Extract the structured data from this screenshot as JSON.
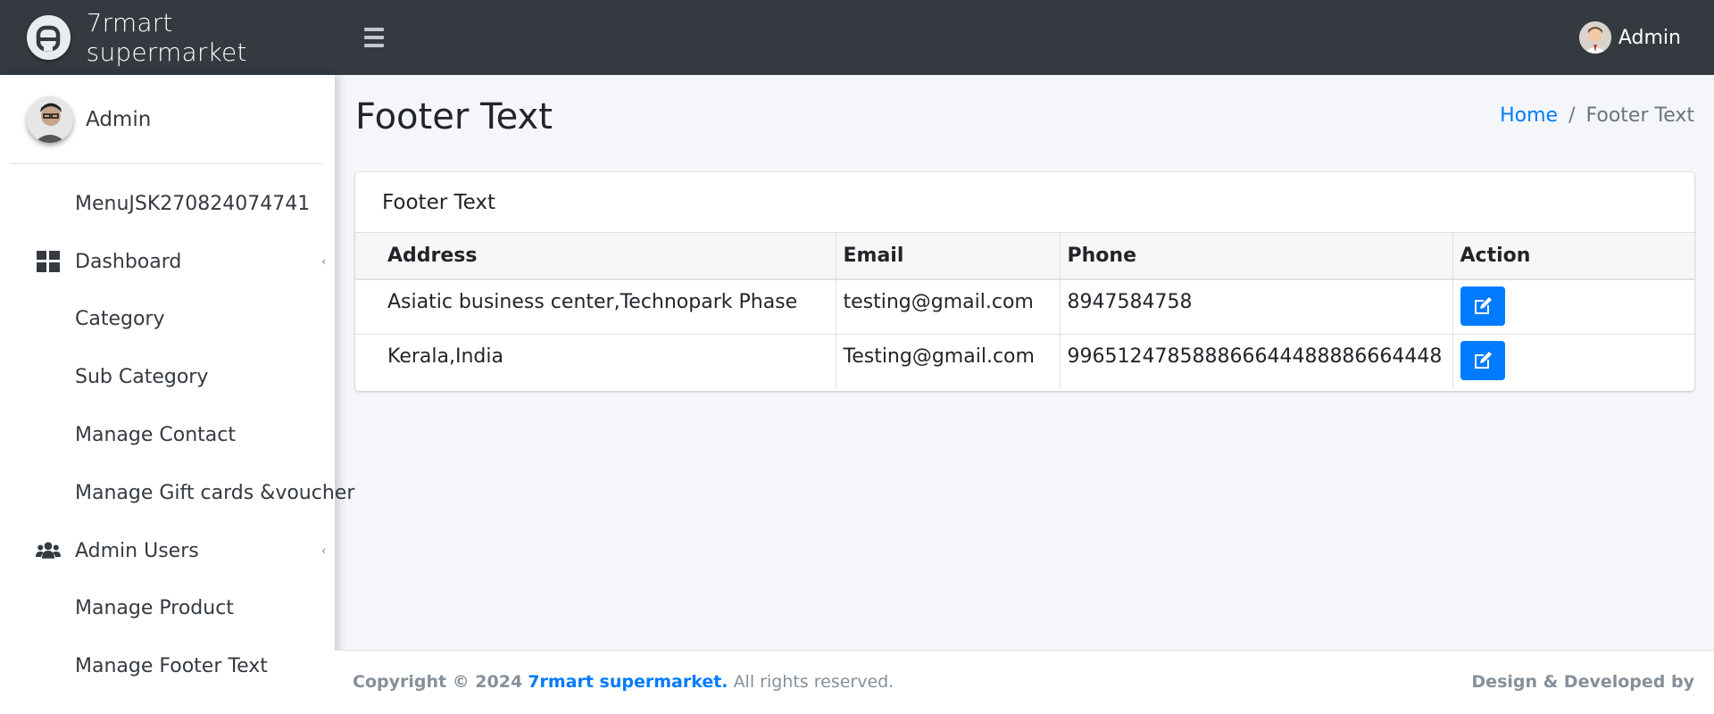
{
  "app": {
    "brand_name": "7rmart supermarket",
    "top_user_name": "Admin"
  },
  "sidebar": {
    "user_name": "Admin",
    "items": [
      {
        "label": "MenuJSK270824074741",
        "icon": ""
      },
      {
        "label": "Dashboard",
        "icon": "dashboard-grid-icon",
        "caret": "‹"
      },
      {
        "label": "Category",
        "icon": ""
      },
      {
        "label": "Sub Category",
        "icon": ""
      },
      {
        "label": "Manage Contact",
        "icon": ""
      },
      {
        "label": "Manage Gift cards &voucher",
        "icon": ""
      },
      {
        "label": "Admin Users",
        "icon": "users-icon",
        "caret": "‹"
      },
      {
        "label": "Manage Product",
        "icon": ""
      },
      {
        "label": "Manage Footer Text",
        "icon": ""
      }
    ]
  },
  "page": {
    "title": "Footer Text",
    "breadcrumb": {
      "home": "Home",
      "separator": "/",
      "current": "Footer Text"
    }
  },
  "card": {
    "title": "Footer Text",
    "columns": [
      "Address",
      "Email",
      "Phone",
      "Action"
    ],
    "rows": [
      {
        "address": "Asiatic business center,Technopark Phase",
        "email": "testing@gmail.com",
        "phone": "8947584758"
      },
      {
        "address": "Kerala,India",
        "email": "Testing@gmail.com",
        "phone": "996512478588866644488886664448"
      }
    ]
  },
  "footer": {
    "copyright": "Copyright © 2024",
    "brand": "7rmart supermarket.",
    "rights": "All rights reserved.",
    "right_text": "Design & Developed by"
  },
  "colors": {
    "navbar": "#343a40",
    "primary": "#007bff",
    "content_bg": "#f4f6f9"
  }
}
